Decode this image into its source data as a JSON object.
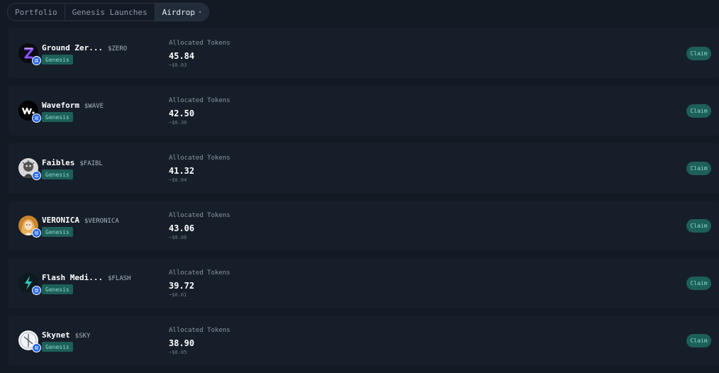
{
  "tabs": [
    {
      "label": "Portfolio"
    },
    {
      "label": "Genesis Launches"
    },
    {
      "label": "Airdrop",
      "caret": "▾"
    }
  ],
  "rows": [
    {
      "name": "Ground Zer...",
      "ticker": "$ZERO",
      "badge": "Genesis",
      "alloc_label": "Allocated Tokens",
      "amount": "45.84",
      "usd": "~$0.03",
      "claim": "Claim",
      "icon": "ground-zero-logo-icon"
    },
    {
      "name": "Waveform",
      "ticker": "$WAVE",
      "badge": "Genesis",
      "alloc_label": "Allocated Tokens",
      "amount": "42.50",
      "usd": "~$0.30",
      "claim": "Claim",
      "icon": "waveform-logo-icon"
    },
    {
      "name": "Faibles",
      "ticker": "$FAIBL",
      "badge": "Genesis",
      "alloc_label": "Allocated Tokens",
      "amount": "41.32",
      "usd": "~$0.04",
      "claim": "Claim",
      "icon": "faibles-logo-icon"
    },
    {
      "name": "VERONICA",
      "ticker": "$VERONICA",
      "badge": "Genesis",
      "alloc_label": "Allocated Tokens",
      "amount": "43.06",
      "usd": "~$0.06",
      "claim": "Claim",
      "icon": "veronica-avatar-icon"
    },
    {
      "name": "Flash Medi...",
      "ticker": "$FLASH",
      "badge": "Genesis",
      "alloc_label": "Allocated Tokens",
      "amount": "39.72",
      "usd": "~$0.01",
      "claim": "Claim",
      "icon": "flash-logo-icon"
    },
    {
      "name": "Skynet",
      "ticker": "$SKY",
      "badge": "Genesis",
      "alloc_label": "Allocated Tokens",
      "amount": "38.90",
      "usd": "~$0.05",
      "claim": "Claim",
      "icon": "skynet-logo-icon"
    }
  ],
  "colors": {
    "background": "#131a24",
    "row": "#161e29",
    "badge_bg": "#1d5f59",
    "badge_text": "#8fdad2",
    "chain_badge": "#2b6be8"
  }
}
